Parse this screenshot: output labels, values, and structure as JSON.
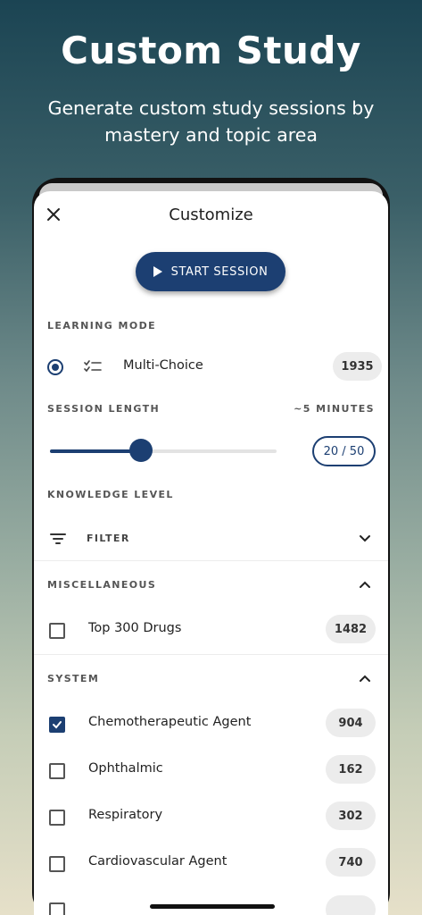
{
  "hero": {
    "title": "Custom Study",
    "subtitle": "Generate custom study sessions by mastery and topic area"
  },
  "sheet": {
    "title": "Customize",
    "start_label": "START SESSION"
  },
  "learning_mode": {
    "label": "LEARNING MODE",
    "option_label": "Multi-Choice",
    "option_count": "1935",
    "selected": true
  },
  "session_length": {
    "label": "SESSION LENGTH",
    "duration": "~5 MINUTES",
    "value_label": "20 / 50",
    "value": 20,
    "max": 50
  },
  "knowledge": {
    "label": "KNOWLEDGE LEVEL",
    "filter_label": "FILTER"
  },
  "misc": {
    "label": "MISCELLANEOUS",
    "items": [
      {
        "label": "Top 300 Drugs",
        "count": "1482",
        "checked": false
      }
    ]
  },
  "system": {
    "label": "SYSTEM",
    "items": [
      {
        "label": "Chemotherapeutic Agent",
        "count": "904",
        "checked": true
      },
      {
        "label": "Ophthalmic",
        "count": "162",
        "checked": false
      },
      {
        "label": "Respiratory",
        "count": "302",
        "checked": false
      },
      {
        "label": "Cardiovascular Agent",
        "count": "740",
        "checked": false
      }
    ]
  },
  "colors": {
    "accent": "#1c3f72",
    "pill_bg": "#ececec"
  }
}
